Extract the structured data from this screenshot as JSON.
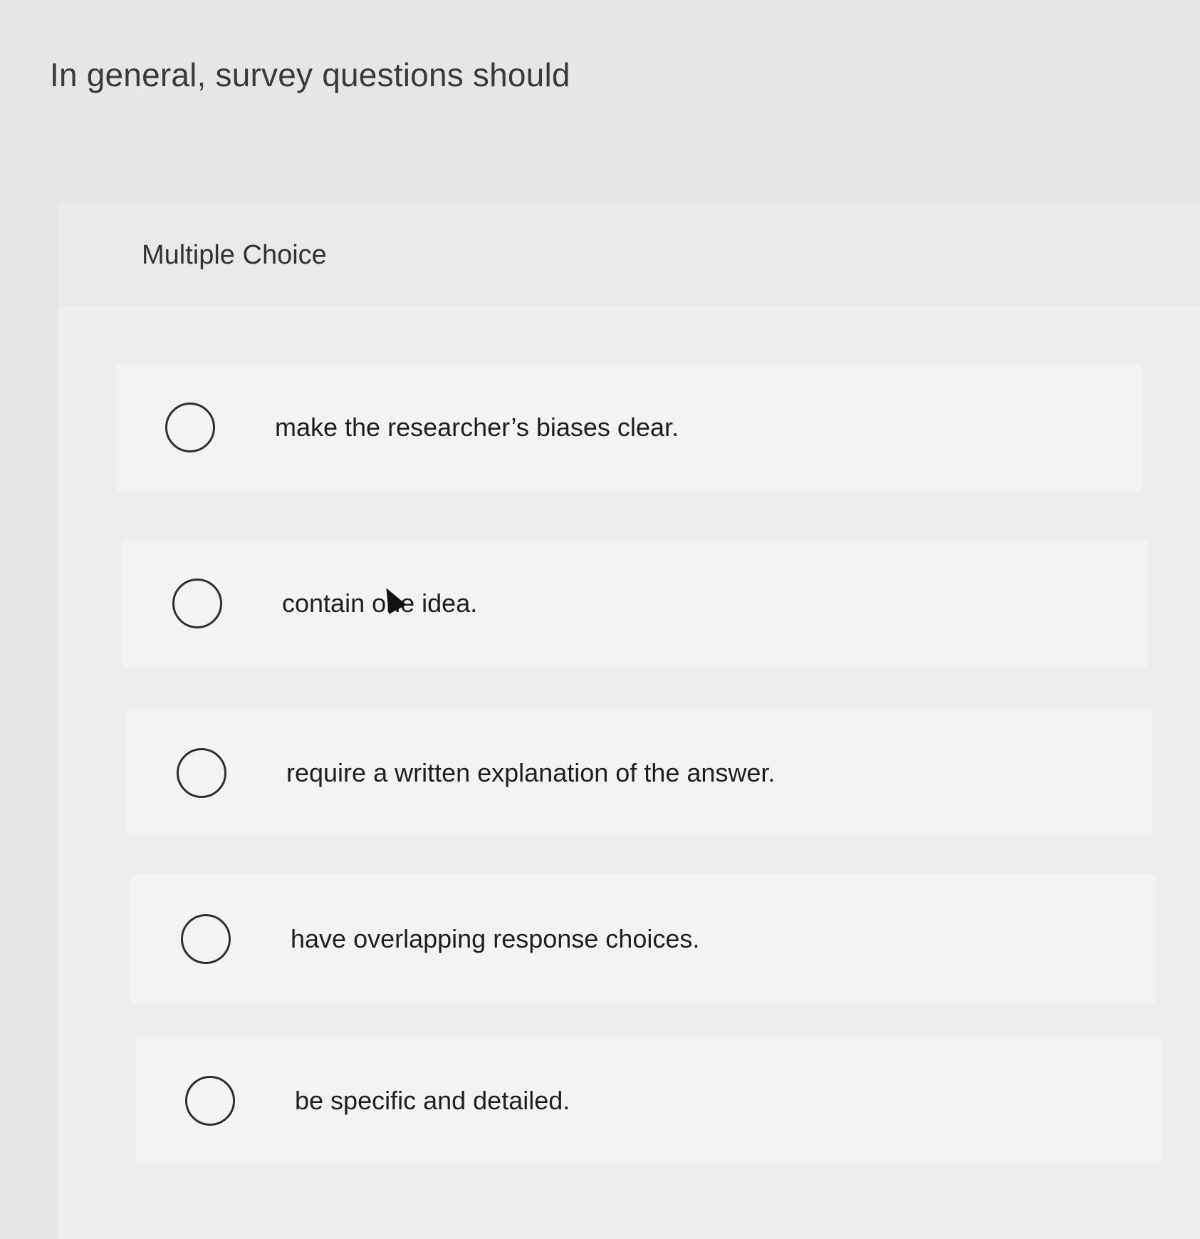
{
  "question": {
    "text": "In general, survey questions should"
  },
  "panel": {
    "label": "Multiple Choice"
  },
  "options": [
    {
      "label": "make the researcher’s biases clear.",
      "selected": false
    },
    {
      "label": "contain one idea.",
      "selected": false
    },
    {
      "label": "require a written explanation of the answer.",
      "selected": false
    },
    {
      "label": "have overlapping response choices.",
      "selected": false
    },
    {
      "label": "be specific and detailed.",
      "selected": false
    }
  ],
  "cursor": {
    "icon": "mouse-pointer-icon"
  }
}
